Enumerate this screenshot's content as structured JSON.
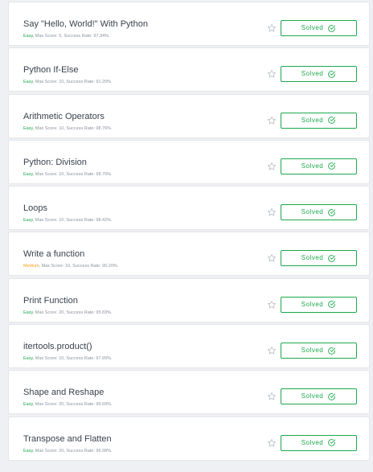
{
  "challenges": [
    {
      "title": "Say \"Hello, World!\" With Python",
      "difficulty": "Easy",
      "max_score": "Max Score: 5",
      "success_rate": "Success Rate: 97.34%.",
      "status": "Solved"
    },
    {
      "title": "Python If-Else",
      "difficulty": "Easy",
      "max_score": "Max Score: 10",
      "success_rate": "Success Rate: 91.20%.",
      "status": "Solved"
    },
    {
      "title": "Arithmetic Operators",
      "difficulty": "Easy",
      "max_score": "Max Score: 10",
      "success_rate": "Success Rate: 98.76%.",
      "status": "Solved"
    },
    {
      "title": "Python: Division",
      "difficulty": "Easy",
      "max_score": "Max Score: 10",
      "success_rate": "Success Rate: 98.70%.",
      "status": "Solved"
    },
    {
      "title": "Loops",
      "difficulty": "Easy",
      "max_score": "Max Score: 10",
      "success_rate": "Success Rate: 98.42%.",
      "status": "Solved"
    },
    {
      "title": "Write a function",
      "difficulty": "Medium",
      "max_score": "Max Score: 10",
      "success_rate": "Success Rate: 90.20%.",
      "status": "Solved"
    },
    {
      "title": "Print Function",
      "difficulty": "Easy",
      "max_score": "Max Score: 20",
      "success_rate": "Success Rate: 95.83%.",
      "status": "Solved"
    },
    {
      "title": "itertools.product()",
      "difficulty": "Easy",
      "max_score": "Max Score: 10",
      "success_rate": "Success Rate: 97.99%.",
      "status": "Solved"
    },
    {
      "title": "Shape and Reshape",
      "difficulty": "Easy",
      "max_score": "Max Score: 20",
      "success_rate": "Success Rate: 96.69%.",
      "status": "Solved"
    },
    {
      "title": "Transpose and Flatten",
      "difficulty": "Easy",
      "max_score": "Max Score: 20",
      "success_rate": "Success Rate: 96.98%.",
      "status": "Solved"
    }
  ],
  "colors": {
    "easy": "#1ba94c",
    "medium": "#ffa116",
    "solved": "#1ba94c",
    "title": "#39424e",
    "meta": "#8a93a0"
  },
  "icons": {
    "star": "star-outline-icon",
    "check": "check-circle-icon"
  }
}
